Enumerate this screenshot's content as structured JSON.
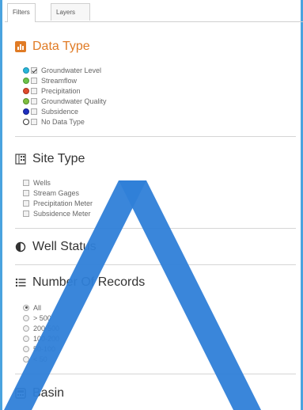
{
  "tabs": [
    {
      "label": "Filters",
      "active": true
    },
    {
      "label": "Layers",
      "active": false
    }
  ],
  "sections": {
    "data_type": {
      "title": "Data Type",
      "icon": "bar-chart-icon",
      "items": [
        {
          "label": "Groundwater Level",
          "dot_color": "#27b6d9",
          "checked": true
        },
        {
          "label": "Streamflow",
          "dot_color": "#6cc24a",
          "checked": false
        },
        {
          "label": "Precipitation",
          "dot_color": "#e04b2c",
          "checked": false
        },
        {
          "label": "Groundwater Quality",
          "dot_color": "#7fbf3f",
          "checked": false
        },
        {
          "label": "Subsidence",
          "dot_color": "#1f2fbf",
          "checked": false
        },
        {
          "label": "No Data Type",
          "dot_color": "#ffffff",
          "checked": false
        }
      ]
    },
    "site_type": {
      "title": "Site Type",
      "icon": "building-icon",
      "items": [
        "Wells",
        "Stream Gages",
        "Precipitation Meter",
        "Subsidence Meter"
      ]
    },
    "well_status": {
      "title": "Well Status",
      "icon": "half-circle-icon"
    },
    "number_of_records": {
      "title": "Number Of Records",
      "icon": "list-icon",
      "options": [
        "All",
        "> 500",
        "200-500",
        "100-200",
        "50-100",
        "< 50"
      ],
      "selected": "All"
    },
    "basin": {
      "title": "Basin",
      "icon": "calculator-icon"
    }
  },
  "colors": {
    "accent_orange": "#e07b25",
    "frame_blue": "#4aa3df",
    "watermark_blue": "#2f80d8"
  }
}
